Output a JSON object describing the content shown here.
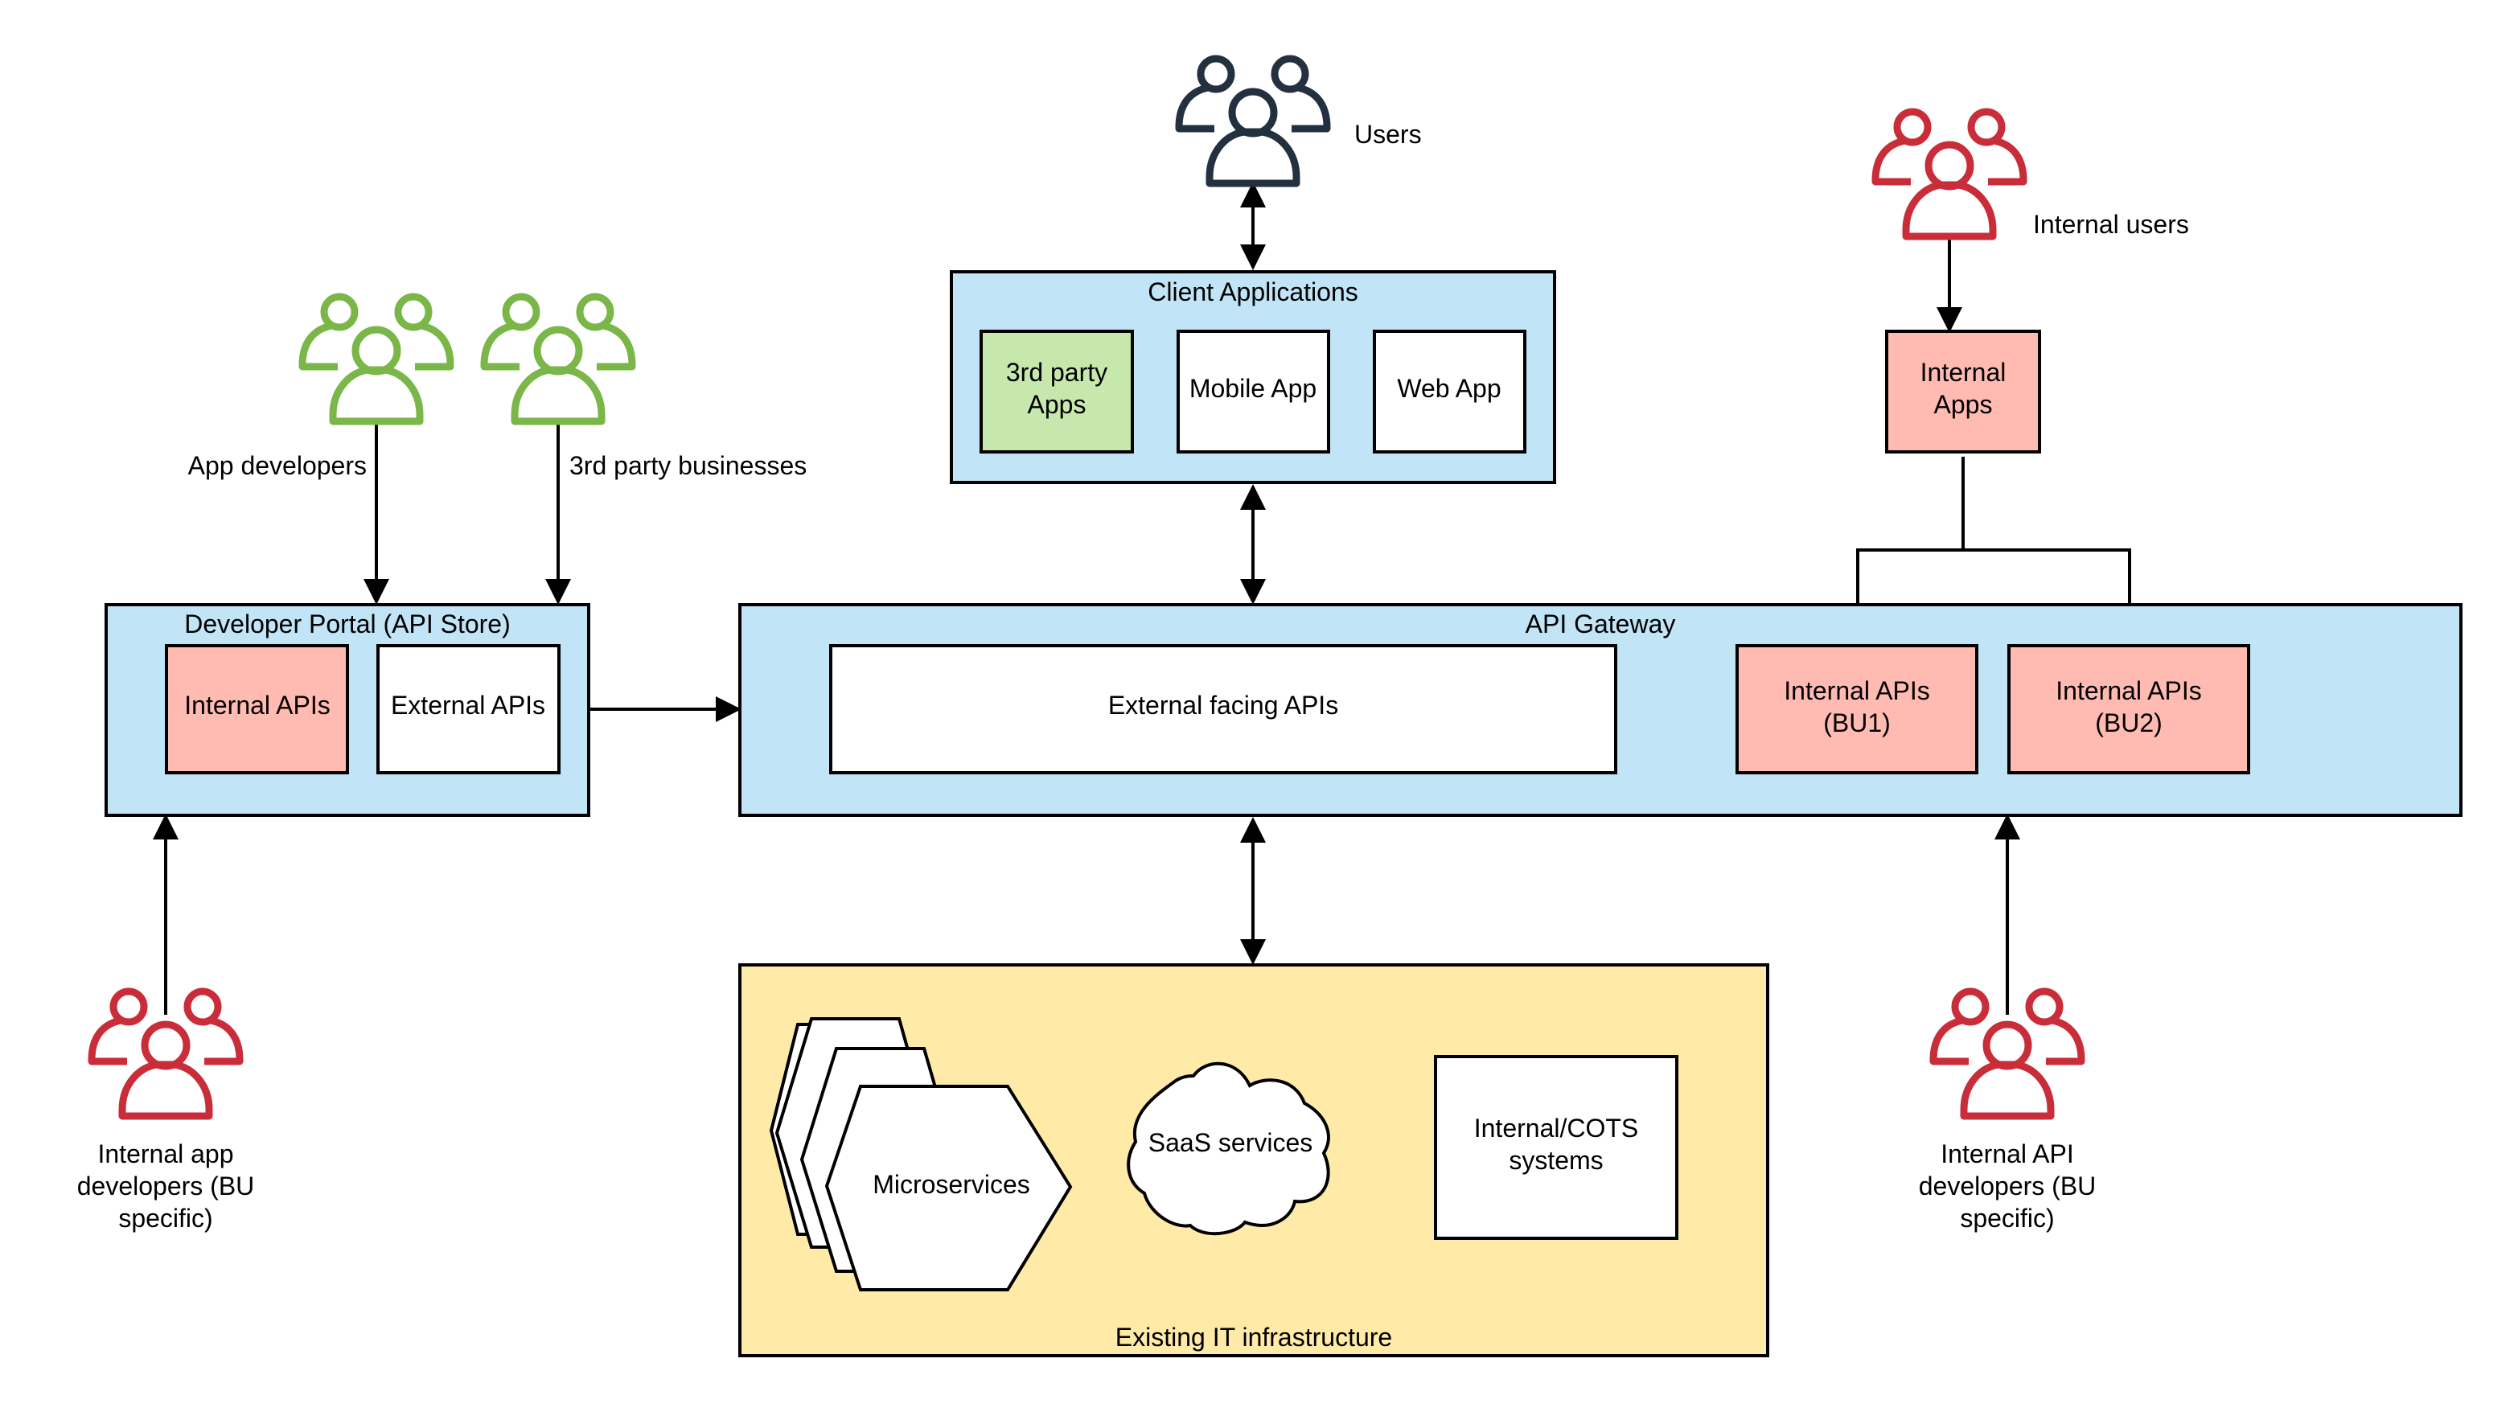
{
  "colors": {
    "container_blue": "#c1e4f7",
    "infra_yellow": "#ffeaa7",
    "internal_pink": "#ffbbb1",
    "third_party_green": "#c7e8ac",
    "white": "#ffffff",
    "user_dark": "#23303f",
    "user_green": "#7ab648",
    "user_red": "#c92d39"
  },
  "actors": {
    "users": {
      "label": "Users",
      "icon": "users-group-icon",
      "color": "user_dark"
    },
    "internal_users": {
      "label": "Internal users",
      "icon": "users-group-icon",
      "color": "user_red"
    },
    "app_developers": {
      "label": "App developers",
      "icon": "users-group-icon",
      "color": "user_green"
    },
    "third_party_businesses": {
      "label": "3rd party businesses",
      "icon": "users-group-icon",
      "color": "user_green"
    },
    "internal_app_developers": {
      "lines": [
        "Internal app",
        "developers (BU",
        "specific)"
      ],
      "icon": "users-group-icon",
      "color": "user_red"
    },
    "internal_api_developers": {
      "lines": [
        "Internal API",
        "developers (BU",
        "specific)"
      ],
      "icon": "users-group-icon",
      "color": "user_red"
    }
  },
  "client_applications": {
    "title": "Client Applications",
    "items": [
      {
        "lines": [
          "3rd party",
          "Apps"
        ],
        "fill": "third_party_green"
      },
      {
        "lines": [
          "Mobile App"
        ],
        "fill": "white"
      },
      {
        "lines": [
          "Web App"
        ],
        "fill": "white"
      }
    ]
  },
  "internal_apps": {
    "lines": [
      "Internal",
      "Apps"
    ]
  },
  "developer_portal": {
    "title": "Developer Portal (API Store)",
    "items": [
      {
        "lines": [
          "Internal APIs"
        ],
        "fill": "internal_pink"
      },
      {
        "lines": [
          "External APIs"
        ],
        "fill": "white"
      }
    ]
  },
  "api_gateway": {
    "title": "API Gateway",
    "external": {
      "lines": [
        "External facing APIs"
      ]
    },
    "internal": [
      {
        "lines": [
          "Internal APIs",
          "(BU1)"
        ]
      },
      {
        "lines": [
          "Internal APIs",
          "(BU2)"
        ]
      }
    ]
  },
  "infrastructure": {
    "title": "Existing IT infrastructure",
    "microservices": "Microservices",
    "saas": "SaaS services",
    "cots": [
      "Internal/COTS",
      "systems"
    ]
  }
}
